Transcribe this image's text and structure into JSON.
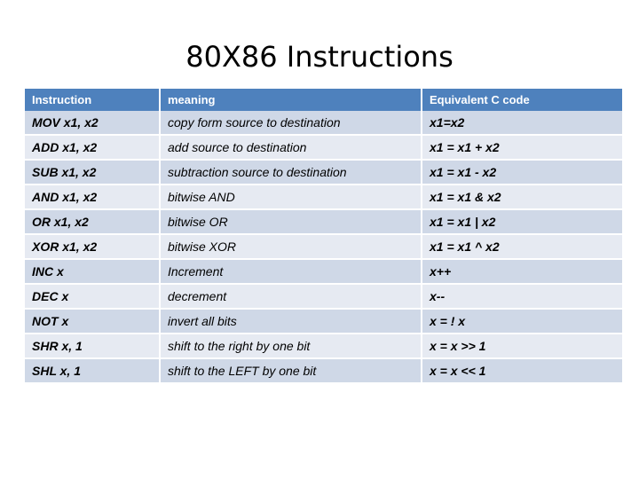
{
  "slide": {
    "title": "80X86 Instructions"
  },
  "table": {
    "headers": {
      "instruction": "Instruction",
      "meaning": "meaning",
      "code": "Equivalent C code"
    },
    "header_bg": "#4E81BD",
    "header_text_color": "#FFFFFF",
    "row_band_a": "#CFD8E7",
    "row_band_b": "#E6EAF2",
    "rows": [
      {
        "instruction": "MOV x1, x2",
        "meaning": "copy form source to destination",
        "code": "x1=x2"
      },
      {
        "instruction": "ADD x1, x2",
        "meaning": "add source to destination",
        "code": "x1 = x1 + x2"
      },
      {
        "instruction": "SUB x1, x2",
        "meaning": "subtraction source to destination",
        "code": "x1 = x1 - x2"
      },
      {
        "instruction": "AND x1, x2",
        "meaning": "bitwise AND",
        "code": "x1 = x1 & x2"
      },
      {
        "instruction": "OR x1, x2",
        "meaning": "bitwise OR",
        "code": "x1 = x1 | x2"
      },
      {
        "instruction": "XOR x1, x2",
        "meaning": "bitwise XOR",
        "code": "x1 = x1 ^ x2"
      },
      {
        "instruction": "INC x",
        "meaning": " Increment",
        "code": "x++"
      },
      {
        "instruction": "DEC x",
        "meaning": "decrement",
        "code": "x--"
      },
      {
        "instruction": "NOT x",
        "meaning": "invert all bits",
        "code": "x = ! x"
      },
      {
        "instruction": "SHR x, 1",
        "meaning": "shift to the right by one bit",
        "code": "x = x >> 1"
      },
      {
        "instruction": "SHL x, 1",
        "meaning": "shift to the LEFT by one bit",
        "code": "x = x << 1"
      }
    ]
  }
}
